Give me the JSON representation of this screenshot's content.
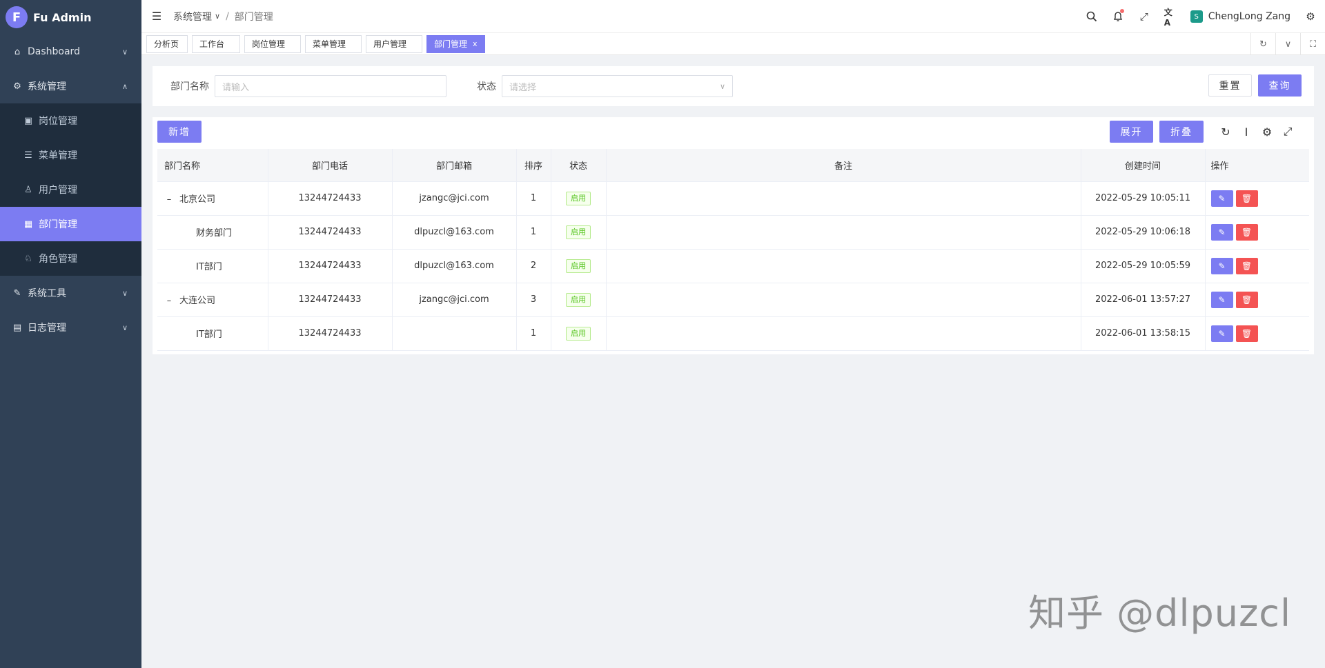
{
  "app": {
    "name": "Fu Admin",
    "logo_letter": "F"
  },
  "sidebar": {
    "items": [
      {
        "label": "Dashboard",
        "icon": "home-icon"
      },
      {
        "label": "系统管理",
        "icon": "gear-icon",
        "expanded": true
      },
      {
        "label": "系统工具",
        "icon": "wrench-icon"
      },
      {
        "label": "日志管理",
        "icon": "document-icon"
      }
    ],
    "system_sub": [
      {
        "label": "岗位管理",
        "icon": "badge-icon"
      },
      {
        "label": "菜单管理",
        "icon": "list-icon"
      },
      {
        "label": "用户管理",
        "icon": "user-icon"
      },
      {
        "label": "部门管理",
        "icon": "building-icon",
        "active": true
      },
      {
        "label": "角色管理",
        "icon": "users-icon"
      }
    ]
  },
  "header": {
    "breadcrumb": [
      "系统管理",
      "部门管理"
    ],
    "breadcrumb_sep": "/",
    "username": "ChengLong Zang",
    "avatar_text": "S"
  },
  "tags": {
    "items": [
      "分析页",
      "工作台",
      "岗位管理",
      "菜单管理",
      "用户管理",
      "部门管理"
    ],
    "active_index": 5,
    "close": "x"
  },
  "search": {
    "dept_label": "部门名称",
    "dept_placeholder": "请输入",
    "status_label": "状态",
    "status_placeholder": "请选择",
    "reset_label": "重置",
    "query_label": "查询"
  },
  "toolbar": {
    "add_label": "新增",
    "expand_label": "展开",
    "collapse_label": "折叠"
  },
  "table": {
    "columns": [
      "部门名称",
      "部门电话",
      "部门邮箱",
      "排序",
      "状态",
      "备注",
      "创建时间",
      "操作"
    ],
    "rows": [
      {
        "name": "北京公司",
        "phone": "13244724433",
        "email": "jzangc@jci.com",
        "sort": "1",
        "status": "启用",
        "note": "",
        "created": "2022-05-29 10:05:11",
        "level": 0,
        "toggle": "–"
      },
      {
        "name": "财务部门",
        "phone": "13244724433",
        "email": "dlpuzcl@163.com",
        "sort": "1",
        "status": "启用",
        "note": "",
        "created": "2022-05-29 10:06:18",
        "level": 1,
        "toggle": ""
      },
      {
        "name": "IT部门",
        "phone": "13244724433",
        "email": "dlpuzcl@163.com",
        "sort": "2",
        "status": "启用",
        "note": "",
        "created": "2022-05-29 10:05:59",
        "level": 1,
        "toggle": ""
      },
      {
        "name": "大连公司",
        "phone": "13244724433",
        "email": "jzangc@jci.com",
        "sort": "3",
        "status": "启用",
        "note": "",
        "created": "2022-06-01 13:57:27",
        "level": 0,
        "toggle": "–"
      },
      {
        "name": "IT部门",
        "phone": "13244724433",
        "email": "",
        "sort": "1",
        "status": "启用",
        "note": "",
        "created": "2022-06-01 13:58:15",
        "level": 1,
        "toggle": ""
      }
    ]
  },
  "watermark": "知乎 @dlpuzcl",
  "colors": {
    "accent": "#7c7cf2",
    "sidebar": "#304156",
    "danger": "#f45353",
    "success": "#52c41a"
  }
}
